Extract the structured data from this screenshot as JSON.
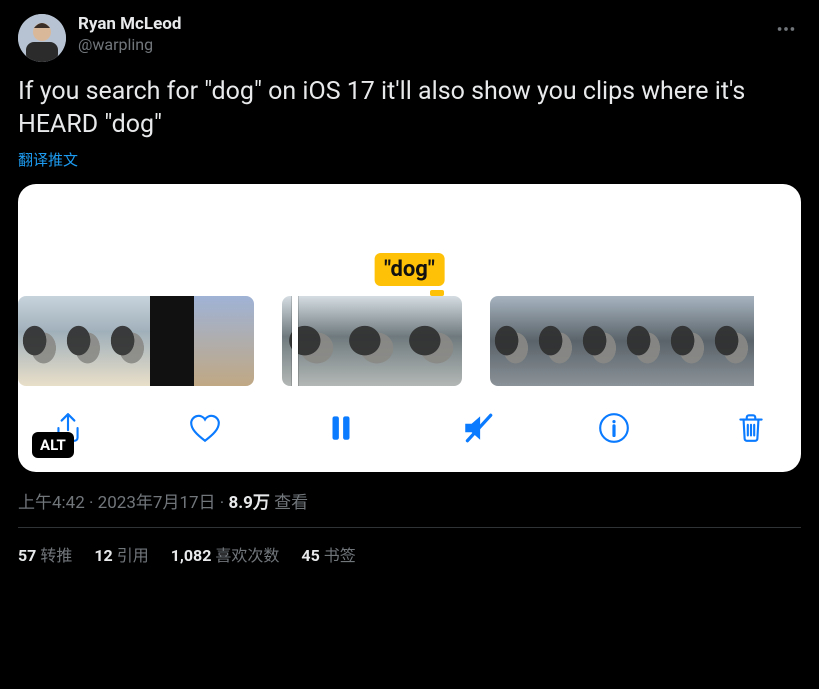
{
  "author": {
    "display_name": "Ryan McLeod",
    "handle": "@warpling"
  },
  "tweet_text": "If you search for \"dog\" on iOS 17 it'll also show you clips where it's HEARD \"dog\"",
  "translate_label": "翻译推文",
  "media": {
    "chip_label": "\"dog\"",
    "alt_badge": "ALT"
  },
  "meta": {
    "time": "上午4:42",
    "date": "2023年7月17日",
    "views_value": "8.9万",
    "views_suffix": "查看"
  },
  "stats": {
    "retweets": {
      "count": "57",
      "label": "转推"
    },
    "quotes": {
      "count": "12",
      "label": "引用"
    },
    "likes": {
      "count": "1,082",
      "label": "喜欢次数"
    },
    "bookmarks": {
      "count": "45",
      "label": "书签"
    }
  }
}
